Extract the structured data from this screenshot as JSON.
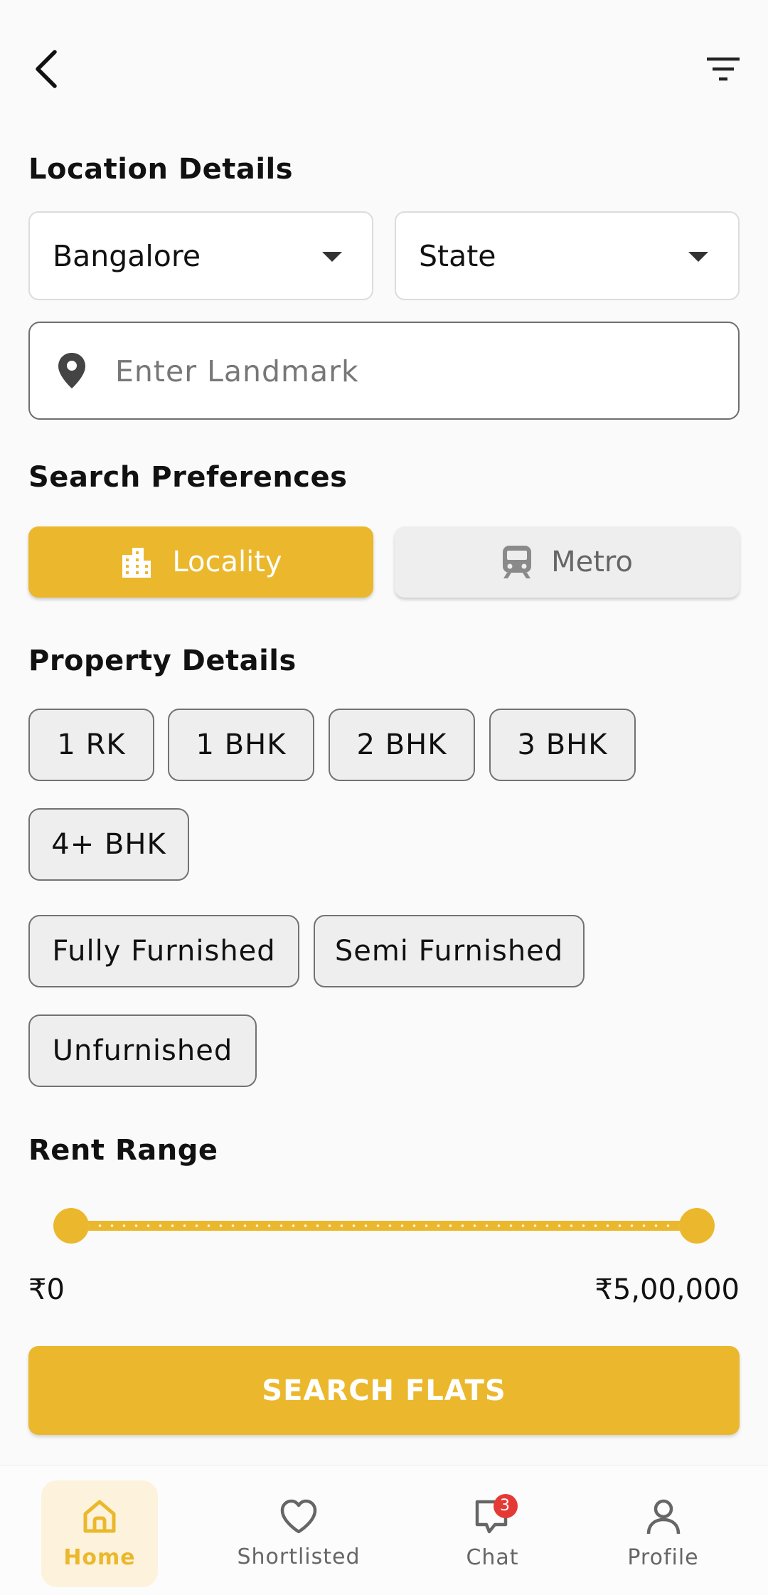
{
  "sections": {
    "location": "Location Details",
    "preferences": "Search Preferences",
    "property": "Property Details",
    "rent": "Rent Range"
  },
  "location": {
    "city": "Bangalore",
    "state": "State",
    "landmark_placeholder": "Enter Landmark"
  },
  "preferences": {
    "locality": "Locality",
    "metro": "Metro",
    "selected": "Locality"
  },
  "property": {
    "bhk": [
      "1 RK",
      "1 BHK",
      "2 BHK",
      "3 BHK",
      "4+ BHK"
    ],
    "furnishing": [
      "Fully Furnished",
      "Semi Furnished",
      "Unfurnished"
    ]
  },
  "rent": {
    "min_label": "₹0",
    "max_label": "₹5,00,000",
    "min_value": 0,
    "max_value": 500000
  },
  "search_label": "SEARCH FLATS",
  "nav": {
    "home": "Home",
    "shortlisted": "Shortlisted",
    "chat": "Chat",
    "chat_badge": "3",
    "profile": "Profile",
    "active": "Home"
  },
  "colors": {
    "accent": "#ebb82d",
    "badge": "#e53935"
  }
}
